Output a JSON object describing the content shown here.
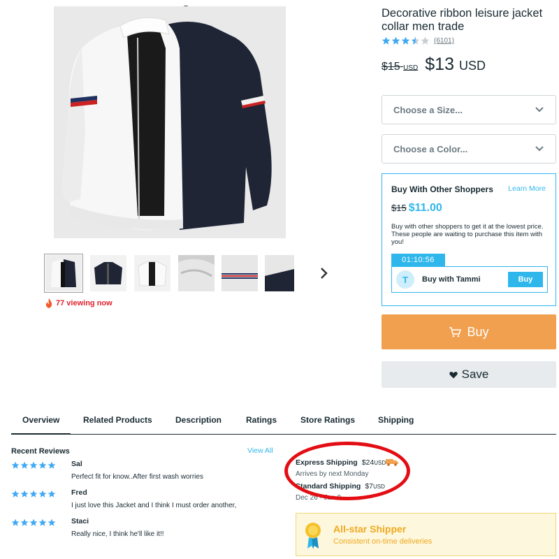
{
  "product": {
    "title": "Decorative ribbon leisure jacket collar men trade",
    "rating_stars": 3.5,
    "review_count": "(6101)",
    "old_price": "$15",
    "old_currency": "USD",
    "price": "$13",
    "currency": "USD",
    "viewing_now": "77 viewing now"
  },
  "options": {
    "size_placeholder": "Choose a Size...",
    "color_placeholder": "Choose a Color..."
  },
  "group_buy": {
    "title": "Buy With Other Shoppers",
    "learn_more": "Learn More",
    "old_price": "$15",
    "new_price": "$11.00",
    "description": "Buy with other shoppers to get it at the lowest price. These people are waiting to purchase this item with you!",
    "timer": "01:10:56",
    "buyer_initial": "T",
    "buyer_label": "Buy with Tammi",
    "buyer_button": "Buy"
  },
  "actions": {
    "buy_label": "Buy",
    "save_label": "Save"
  },
  "tabs": [
    {
      "label": "Overview",
      "active": true
    },
    {
      "label": "Related Products"
    },
    {
      "label": "Description"
    },
    {
      "label": "Ratings"
    },
    {
      "label": "Store Ratings"
    },
    {
      "label": "Shipping"
    }
  ],
  "reviews": {
    "title": "Recent Reviews",
    "view_all": "View All",
    "items": [
      {
        "name": "Sal",
        "stars": 5,
        "text": "Perfect fit for know..After first wash worries"
      },
      {
        "name": "Fred",
        "stars": 5,
        "text": "I just love this Jacket and I think I must order another,"
      },
      {
        "name": "Staci",
        "stars": 5,
        "text": "Really nice, I think he'll like it!!"
      }
    ]
  },
  "shipping": {
    "express": {
      "name": "Express Shipping",
      "price": "$24",
      "currency": "USD",
      "note": "Arrives by next Monday"
    },
    "standard": {
      "name": "Standard Shipping",
      "price": "$7",
      "currency": "USD",
      "note": "Dec 26 - Jan 9"
    },
    "allstar_title": "All-star Shipper",
    "allstar_subtitle": "Consistent on-time deliveries"
  },
  "colors": {
    "accent_blue": "#2fb7ec",
    "buy_orange": "#f1a04f",
    "text_dark": "#192a32",
    "alert_red": "#e0222e",
    "annotation_red": "#e30d13",
    "allstar_gold": "#f0a91e"
  },
  "icons": {
    "flame": "flame-icon",
    "cart": "cart-icon",
    "heart": "heart-icon",
    "chevron": "chevron-down-icon",
    "next": "chevron-right-icon",
    "truck": "truck-icon",
    "medal": "medal-icon"
  }
}
